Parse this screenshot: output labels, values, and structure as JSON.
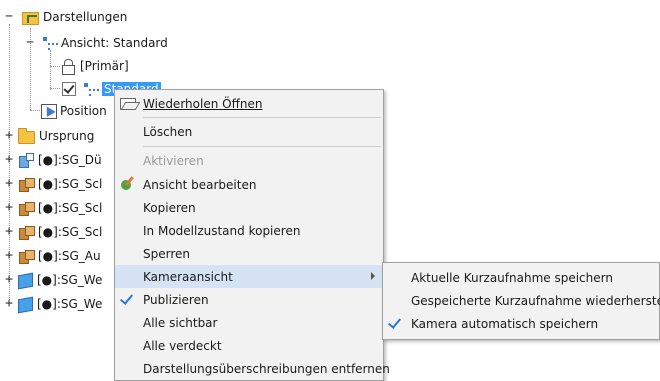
{
  "tree": {
    "representations": "Darstellungen",
    "view_standard": "Ansicht: Standard",
    "primary": "[Primär]",
    "standard": "Standard",
    "position": "Position",
    "origin": "Ursprung",
    "components": [
      "[●]:SG_Dü",
      "[●]:SG_Scl",
      "[●]:SG_Scl",
      "[●]:SG_Scl",
      "[●]:SG_Au",
      "[●]:SG_We",
      "[●]:SG_We"
    ]
  },
  "context_menu": {
    "items": [
      {
        "label": "Wiederholen Öffnen",
        "state": "normal"
      },
      {
        "label": "Löschen",
        "state": "normal"
      },
      {
        "label": "Aktivieren",
        "state": "disabled"
      },
      {
        "label": "Ansicht bearbeiten",
        "state": "normal"
      },
      {
        "label": "Kopieren",
        "state": "normal"
      },
      {
        "label": "In Modellzustand kopieren",
        "state": "normal"
      },
      {
        "label": "Sperren",
        "state": "normal"
      },
      {
        "label": "Kameraansicht",
        "state": "highlighted",
        "submenu": true
      },
      {
        "label": "Publizieren",
        "state": "checked"
      },
      {
        "label": "Alle sichtbar",
        "state": "normal"
      },
      {
        "label": "Alle verdeckt",
        "state": "normal"
      },
      {
        "label": "Darstellungsüberschreibungen entfernen",
        "state": "normal"
      }
    ]
  },
  "submenu": {
    "items": [
      {
        "label": "Aktuelle Kurzaufnahme speichern",
        "checked": false
      },
      {
        "label": "Gespeicherte Kurzaufnahme wiederherstellen",
        "checked": false
      },
      {
        "label": "Kamera automatisch speichern",
        "checked": true
      }
    ]
  },
  "colors": {
    "selection": "#3399ff",
    "menu_bg": "#f2f2f2",
    "hover": "#d5e3f5",
    "check": "#2b79d6"
  }
}
